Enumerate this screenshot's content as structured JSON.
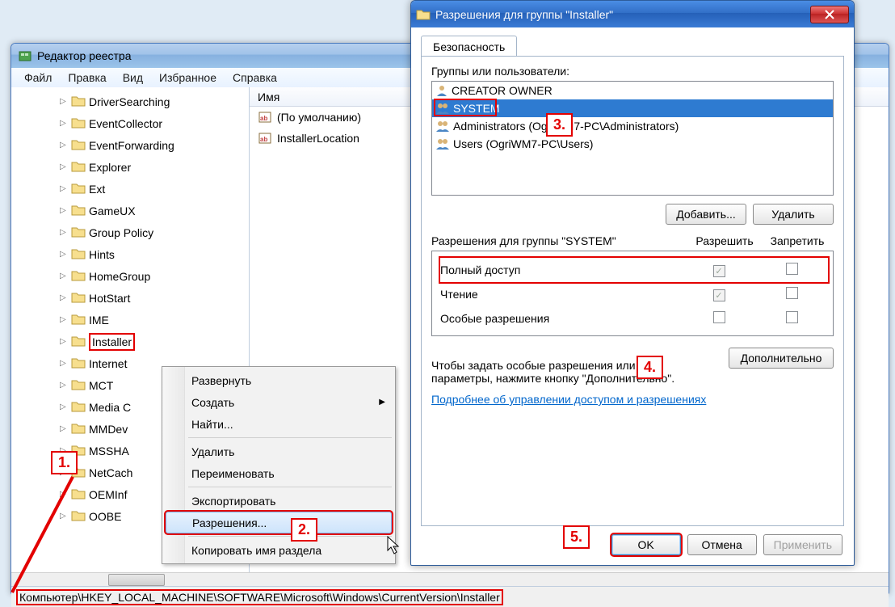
{
  "regedit": {
    "title": "Редактор реестра",
    "menubar": [
      "Файл",
      "Правка",
      "Вид",
      "Избранное",
      "Справка"
    ],
    "tree": [
      "DriverSearching",
      "EventCollector",
      "EventForwarding",
      "Explorer",
      "Ext",
      "GameUX",
      "Group Policy",
      "Hints",
      "HomeGroup",
      "HotStart",
      "IME",
      "Installer",
      "Internet",
      "MCT",
      "Media C",
      "MMDev",
      "MSSHA",
      "NetCach",
      "OEMInf",
      "OOBE"
    ],
    "selected_key": "Installer",
    "values_header": "Имя",
    "values": [
      "(По умолчанию)",
      "InstallerLocation"
    ],
    "statusbar": "Компьютер\\HKEY_LOCAL_MACHINE\\SOFTWARE\\Microsoft\\Windows\\CurrentVersion\\Installer"
  },
  "context_menu": {
    "items": [
      {
        "label": "Развернуть"
      },
      {
        "label": "Создать",
        "submenu": true
      },
      {
        "label": "Найти..."
      },
      {
        "sep": true
      },
      {
        "label": "Удалить"
      },
      {
        "label": "Переименовать"
      },
      {
        "sep": true
      },
      {
        "label": "Экспортировать"
      },
      {
        "label": "Разрешения...",
        "hover": true,
        "boxed": true
      },
      {
        "sep": true
      },
      {
        "label": "Копировать имя раздела"
      }
    ]
  },
  "permissions": {
    "title": "Разрешения для группы \"Installer\"",
    "tab": "Безопасность",
    "groups_label": "Группы или пользователи:",
    "users": [
      {
        "name": "CREATOR OWNER"
      },
      {
        "name": "SYSTEM",
        "selected": true,
        "boxed": true
      },
      {
        "name": "Administrators (OgriWM7-PC\\Administrators)"
      },
      {
        "name": "Users (OgriWM7-PC\\Users)"
      }
    ],
    "add_btn": "Добавить...",
    "remove_btn": "Удалить",
    "perms_for_label": "Разрешения для группы \"SYSTEM\"",
    "col_allow": "Разрешить",
    "col_deny": "Запретить",
    "perm_rows": [
      {
        "label": "Полный доступ",
        "allow": "checked-gray",
        "deny": "",
        "boxed": true
      },
      {
        "label": "Чтение",
        "allow": "checked-gray",
        "deny": ""
      },
      {
        "label": "Особые разрешения",
        "allow": "",
        "deny": ""
      }
    ],
    "hint": "Чтобы задать особые разрешения или параметры, нажмите кнопку \"Дополнительно\".",
    "advanced_btn": "Дополнительно",
    "learn_more": "Подробнее об управлении доступом и разрешениях",
    "ok": "OK",
    "cancel": "Отмена",
    "apply": "Применить"
  },
  "callouts": {
    "1": "1.",
    "2": "2.",
    "3": "3.",
    "4": "4.",
    "5": "5."
  }
}
